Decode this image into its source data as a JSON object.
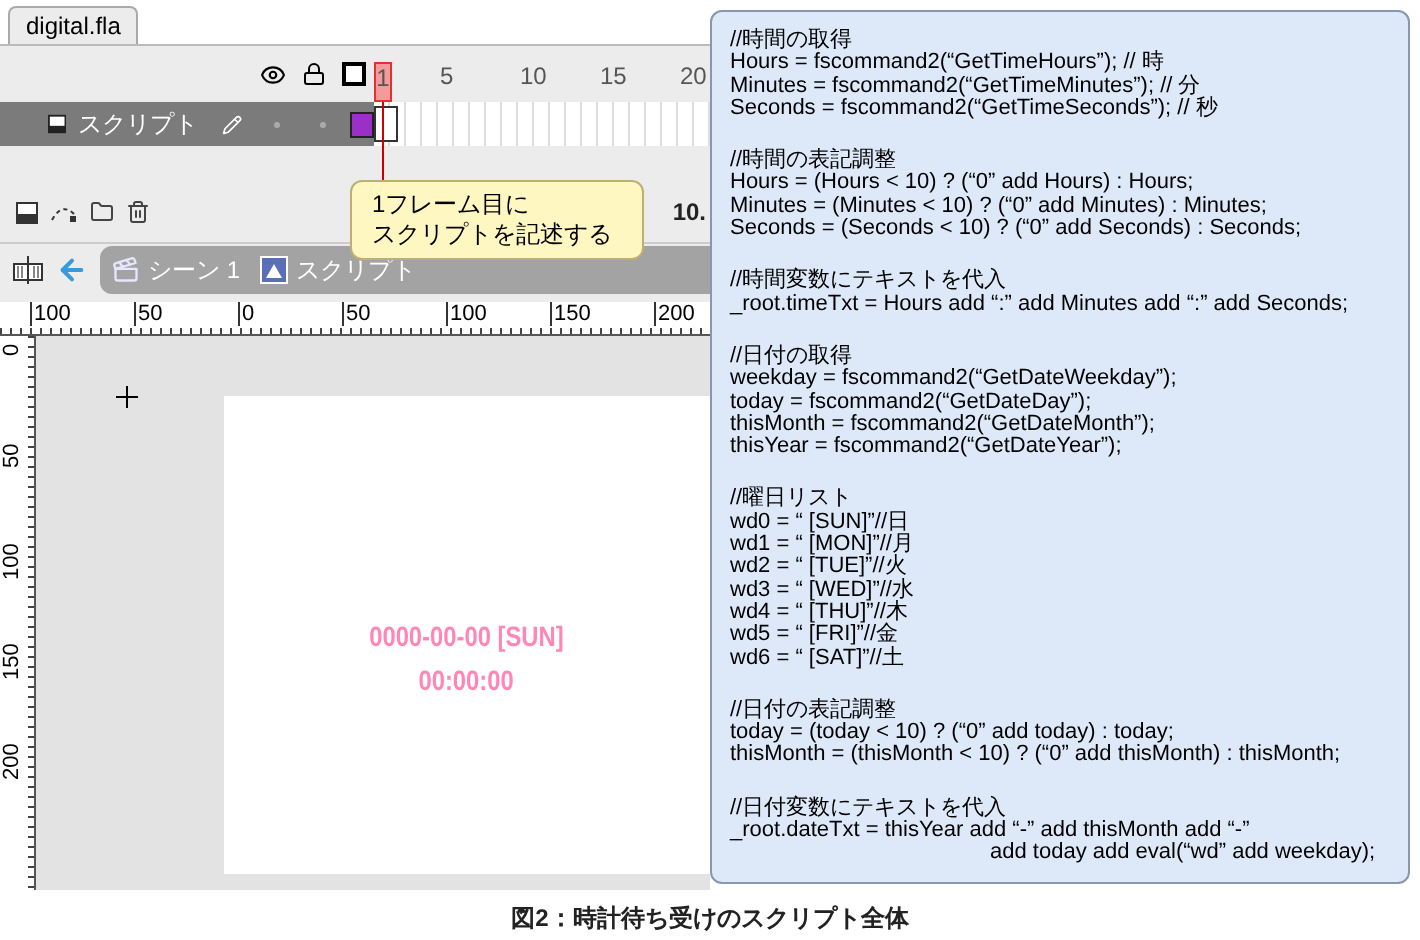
{
  "document_tab": {
    "label": "digital.fla",
    "selected": true
  },
  "timeline": {
    "frame_numbers": [
      "1",
      "5",
      "10",
      "15",
      "20"
    ],
    "layers": [
      {
        "name": "スクリプト",
        "selected": true
      }
    ],
    "callout": [
      "1フレーム目に",
      "スクリプトを記述する"
    ],
    "frame_rate": "10."
  },
  "edit_bar": {
    "breadcrumbs": [
      {
        "label": "シーン 1",
        "kind": "scene"
      },
      {
        "label": "スクリプト",
        "kind": "symbol"
      }
    ]
  },
  "rulers": {
    "horizontal": [
      "100",
      "50",
      "0",
      "50",
      "100",
      "150",
      "200"
    ],
    "vertical": [
      "0",
      "50",
      "100",
      "150",
      "200"
    ]
  },
  "stage": {
    "texts": [
      "0000-00-00 [SUN]",
      "00:00:00"
    ]
  },
  "code": {
    "blocks": [
      [
        {
          "text": "//時間の取得"
        },
        {
          "text": "Hours = fscommand2(“GetTimeHours”); // 時"
        },
        {
          "text": "Minutes = fscommand2(“GetTimeMinutes”); // 分"
        },
        {
          "text": "Seconds = fscommand2(“GetTimeSeconds”); // 秒"
        }
      ],
      [
        {
          "text": "//時間の表記調整"
        },
        {
          "text": "Hours = (Hours < 10) ? (“0” add Hours) : Hours;"
        },
        {
          "text": "Minutes = (Minutes < 10) ? (“0” add Minutes) : Minutes;"
        },
        {
          "text": "Seconds = (Seconds < 10) ? (“0” add Seconds) : Seconds;"
        }
      ],
      [
        {
          "text": "//時間変数にテキストを代入"
        },
        {
          "text": "_root.timeTxt = Hours add “:” add Minutes add “:” add Seconds;"
        }
      ],
      [
        {
          "text": "//日付の取得"
        },
        {
          "text": "weekday = fscommand2(“GetDateWeekday”);"
        },
        {
          "text": "today = fscommand2(“GetDateDay”);"
        },
        {
          "text": "thisMonth = fscommand2(“GetDateMonth”);"
        },
        {
          "text": "thisYear = fscommand2(“GetDateYear”);"
        }
      ],
      [
        {
          "text": "//曜日リスト"
        },
        {
          "text": "wd0 = “ [SUN]”//日"
        },
        {
          "text": "wd1 = “ [MON]”//月"
        },
        {
          "text": "wd2 = “ [TUE]”//火"
        },
        {
          "text": "wd3 = “ [WED]”//水"
        },
        {
          "text": "wd4 = “ [THU]”//木"
        },
        {
          "text": "wd5 = “ [FRI]”//金"
        },
        {
          "text": "wd6 = “ [SAT]”//土"
        }
      ],
      [
        {
          "text": "//日付の表記調整"
        },
        {
          "text": "today = (today < 10) ? (“0” add today) : today;"
        },
        {
          "text": "thisMonth = (thisMonth < 10) ? (“0” add thisMonth) : thisMonth;"
        }
      ],
      [
        {
          "text": "//日付変数にテキストを代入"
        },
        {
          "text": "_root.dateTxt = thisYear add “-” add thisMonth add “-”"
        },
        {
          "text": "add today add eval(“wd” add weekday);",
          "kind": "continuation"
        }
      ]
    ]
  },
  "caption": "図2：時計待ち受けのスクリプト全体"
}
